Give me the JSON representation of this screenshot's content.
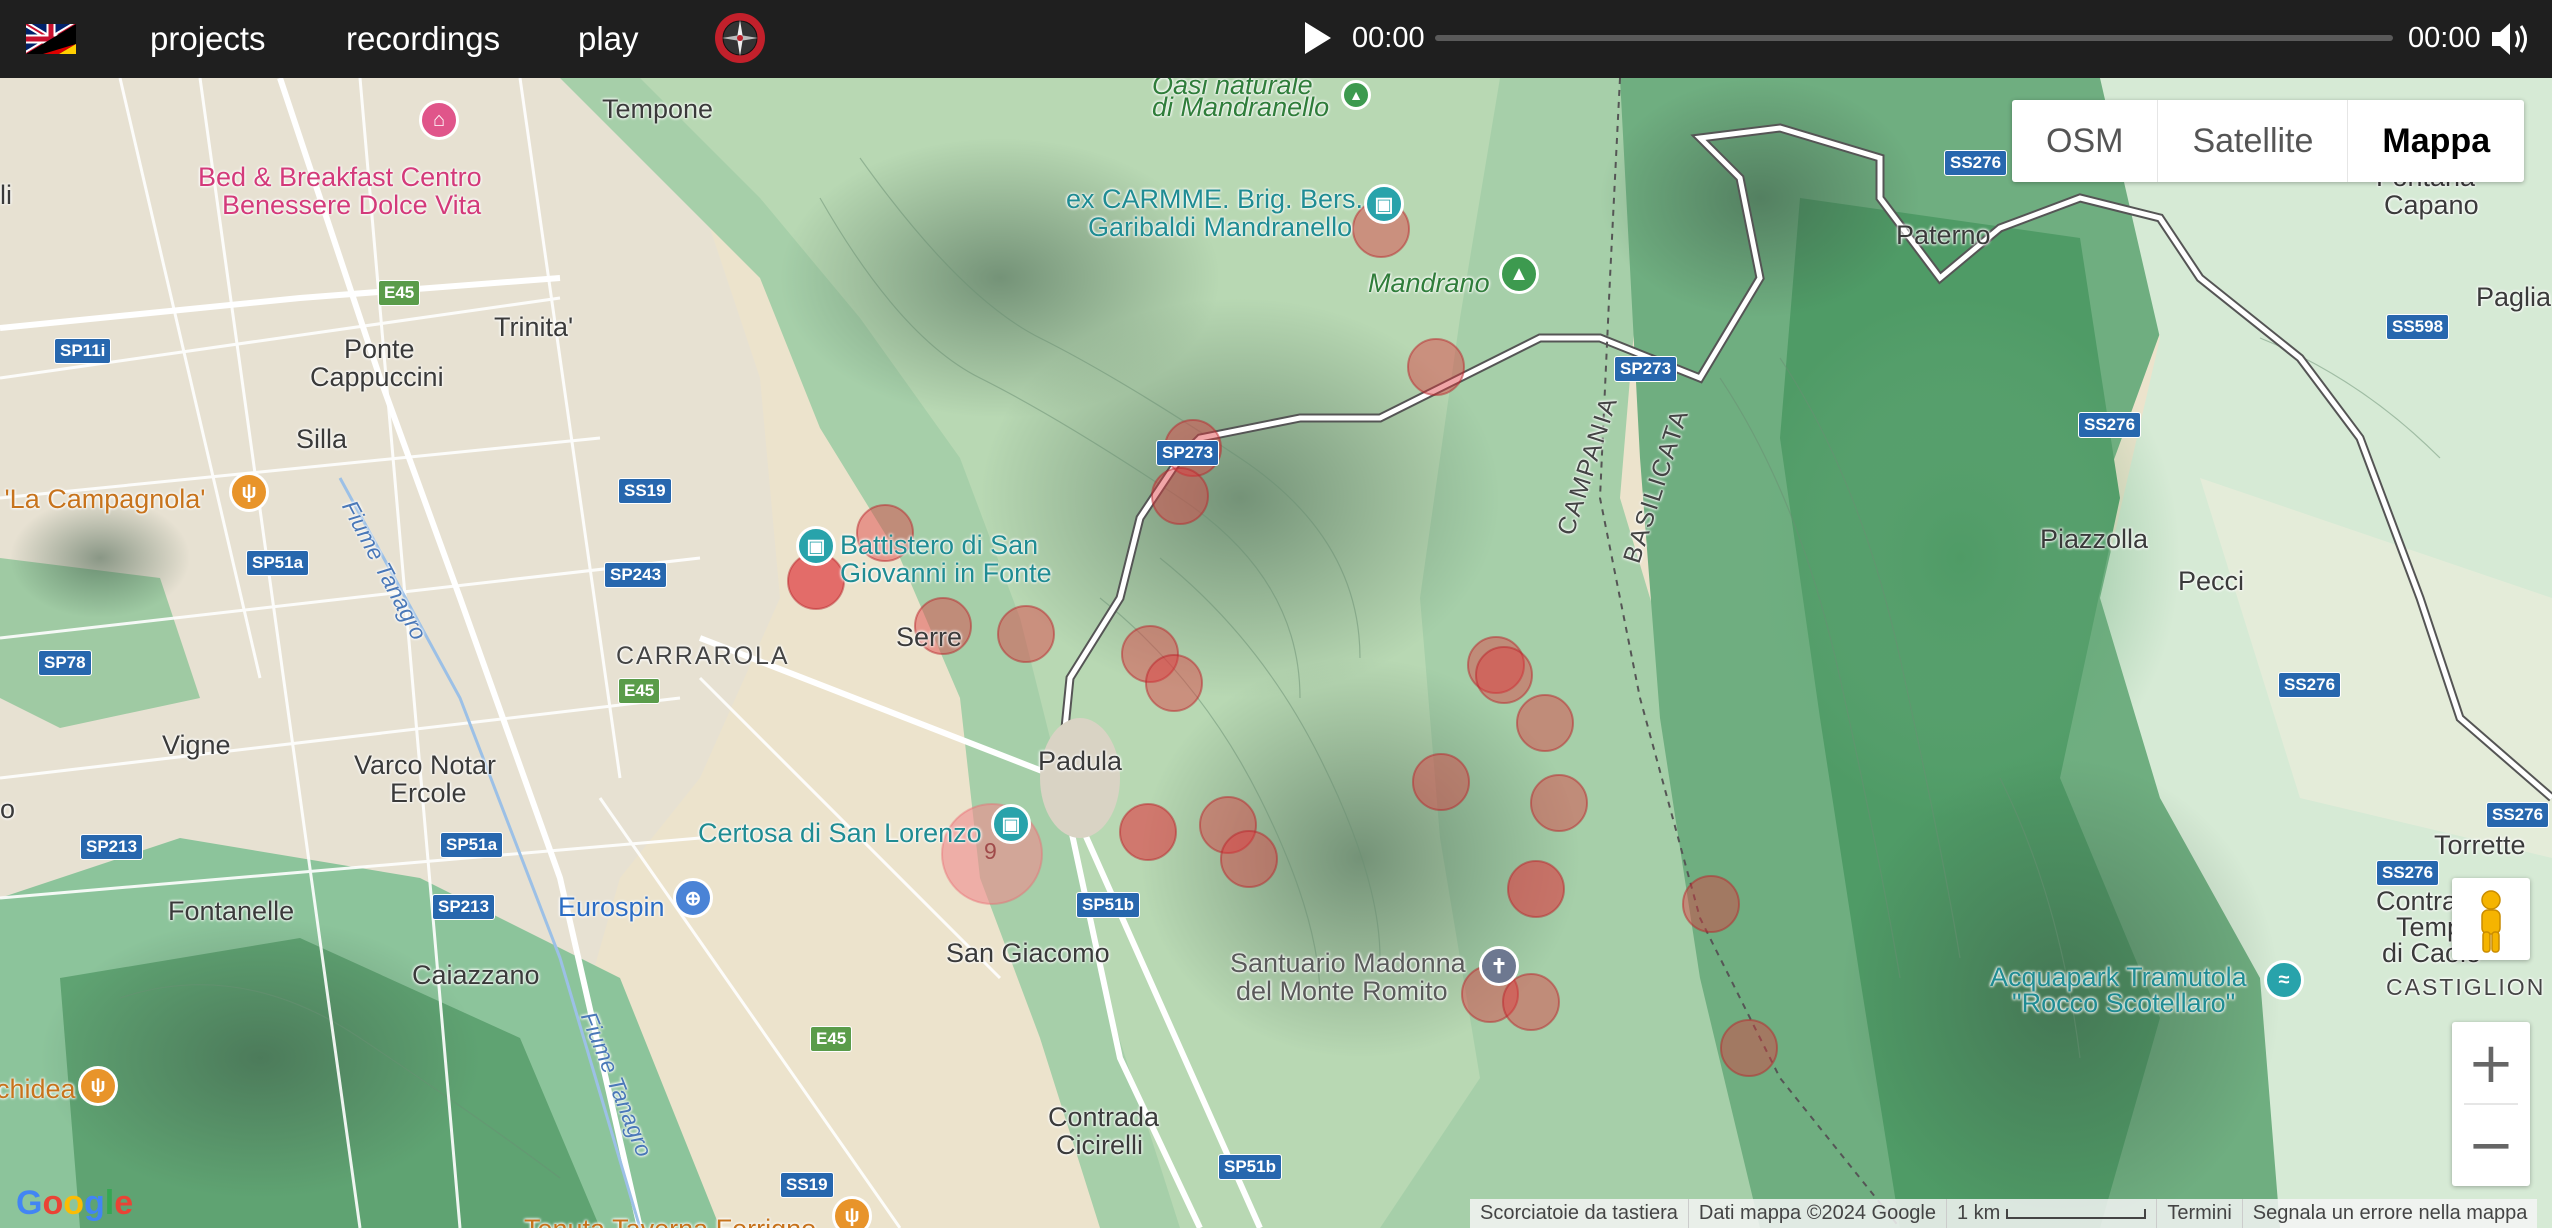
{
  "topbar": {
    "nav": [
      "projects",
      "recordings",
      "play"
    ],
    "time_current": "00:00",
    "time_total": "00:00",
    "icons": {
      "flag": "uk-germany-flag-icon",
      "compass": "compass-icon",
      "play": "play-icon",
      "volume": "volume-icon"
    }
  },
  "maptype": {
    "options": [
      "OSM",
      "Satellite",
      "Mappa"
    ],
    "selected": "Mappa"
  },
  "labels": {
    "tempone": "Tempone",
    "bnb1": "Bed & Breakfast Centro",
    "bnb2": "Benessere Dolce Vita",
    "trinita": "Trinita'",
    "ponte": "Ponte",
    "cappuccini": "Cappuccini",
    "silla": "Silla",
    "campagnola": "a 'La Campagnola'",
    "flume1": "Fiume Tanagro",
    "flume2": "Fiume Tanagro",
    "battistero1": "Battistero di San",
    "battistero2": "Giovanni in Fonte",
    "serre": "Serre",
    "carrarola": "CARRAROLA",
    "vigne": "Vigne",
    "varco1": "Varco Notar",
    "varco2": "Ercole",
    "padula": "Padula",
    "certosa": "Certosa di San Lorenzo",
    "eurospin": "Eurospin",
    "fontanelle": "Fontanelle",
    "caiazzano": "Caiazzano",
    "sangiacomo": "San Giacomo",
    "contrada1": "Contrada",
    "contrada2": "Cicirelli",
    "oasi1": "Oasi naturale",
    "oasi2": "di Mandranello",
    "excarmme1": "ex CARMME. Brig. Bers.",
    "excarmme2": "Garibaldi Mandranello",
    "mandrano": "Mandrano",
    "campania": "CAMPANIA",
    "basilicata": "BASILICATA",
    "paterno": "Paterno",
    "fontana1": "Fontana",
    "fontana2": "Capano",
    "paglia": "Paglia",
    "piazzolla": "Piazzolla",
    "pecci": "Pecci",
    "santuario1": "Santuario Madonna",
    "santuario2": "del Monte Romito",
    "acquapark1": "Acquapark Tramutola",
    "acquapark2": "\"Rocco Scotellaro\"",
    "torrette": "Torrette",
    "contra1": "Contra",
    "contra2": "Temp",
    "contra3": "di Caolo",
    "castiglion": "CASTIGLION",
    "chidea": "chidea",
    "tenuta": "Tenuta Taverna Ferrigno",
    "li": "li",
    "o": "o"
  },
  "shields": {
    "ss276a": "SS276",
    "e45a": "E45",
    "sp11i": "SP11i",
    "ss19a": "SS19",
    "sp243": "SP243",
    "sp51a1": "SP51a",
    "sp78": "SP78",
    "e45b": "E45",
    "sp273a": "SP273",
    "sp273b": "SP273",
    "ss598": "SS598",
    "ss276b": "SS276",
    "ss276c": "SS276",
    "sp213a": "SP213",
    "sp51a2": "SP51a",
    "sp213b": "SP213",
    "sp51b1": "SP51b",
    "e45c": "E45",
    "ss19b": "SS19",
    "sp51b2": "SP51b",
    "ss276d": "SS276",
    "ss276e": "SS276"
  },
  "cluster_count": "9",
  "attribution": {
    "google": "Google",
    "shortcuts": "Scorciatoie da tastiera",
    "mapdata": "Dati mappa ©2024 Google",
    "scale": "1 km",
    "terms": "Termini",
    "report": "Segnala un errore nella mappa"
  },
  "zoom": {
    "in": "+",
    "out": "−"
  },
  "colors": {
    "marker": "#e0393f",
    "topbar": "#1f1f1f",
    "forest": "#7fbf94",
    "plain": "#ece0c8"
  }
}
